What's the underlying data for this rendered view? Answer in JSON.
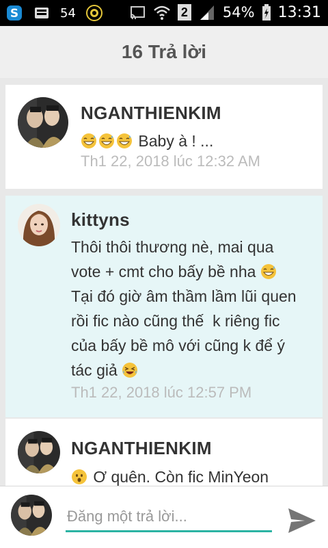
{
  "statusbar": {
    "left_count": "54",
    "sim_slot": "2",
    "battery_percent": "54%",
    "time": "13:31"
  },
  "header": {
    "title": "16 Trả lời"
  },
  "comments": [
    {
      "author": "NGANTHIENKIM",
      "text": "Baby à ! ...",
      "emojis": [
        "grin-sweat",
        "grin-sweat",
        "grin-sweat"
      ],
      "timestamp": "Th1 22, 2018 lúc 12:32 AM",
      "highlighted": false
    },
    {
      "author": "kittyns",
      "text_lines": [
        "Thôi thôi thương nè, mai qua",
        "vote + cmt cho bấy bề nha",
        "Tại đó giờ âm thầm lầm lũi quen",
        "rồi fic nào cũng thế  k riêng fic",
        "của bấy bề mô với cũng k để ý",
        "tác giả"
      ],
      "timestamp": "Th1 22, 2018 lúc 12:57 PM",
      "highlighted": true
    },
    {
      "author": "NGANTHIENKIM",
      "text": "Ơ quên. Còn fic MinYeon",
      "emoji": "surprised",
      "highlighted": false
    }
  ],
  "reply": {
    "placeholder": "Đăng một trả lời..."
  },
  "colors": {
    "accent": "#2bb3a3",
    "highlight_bg": "#e6f6f7",
    "timestamp": "#bbbbbb"
  }
}
